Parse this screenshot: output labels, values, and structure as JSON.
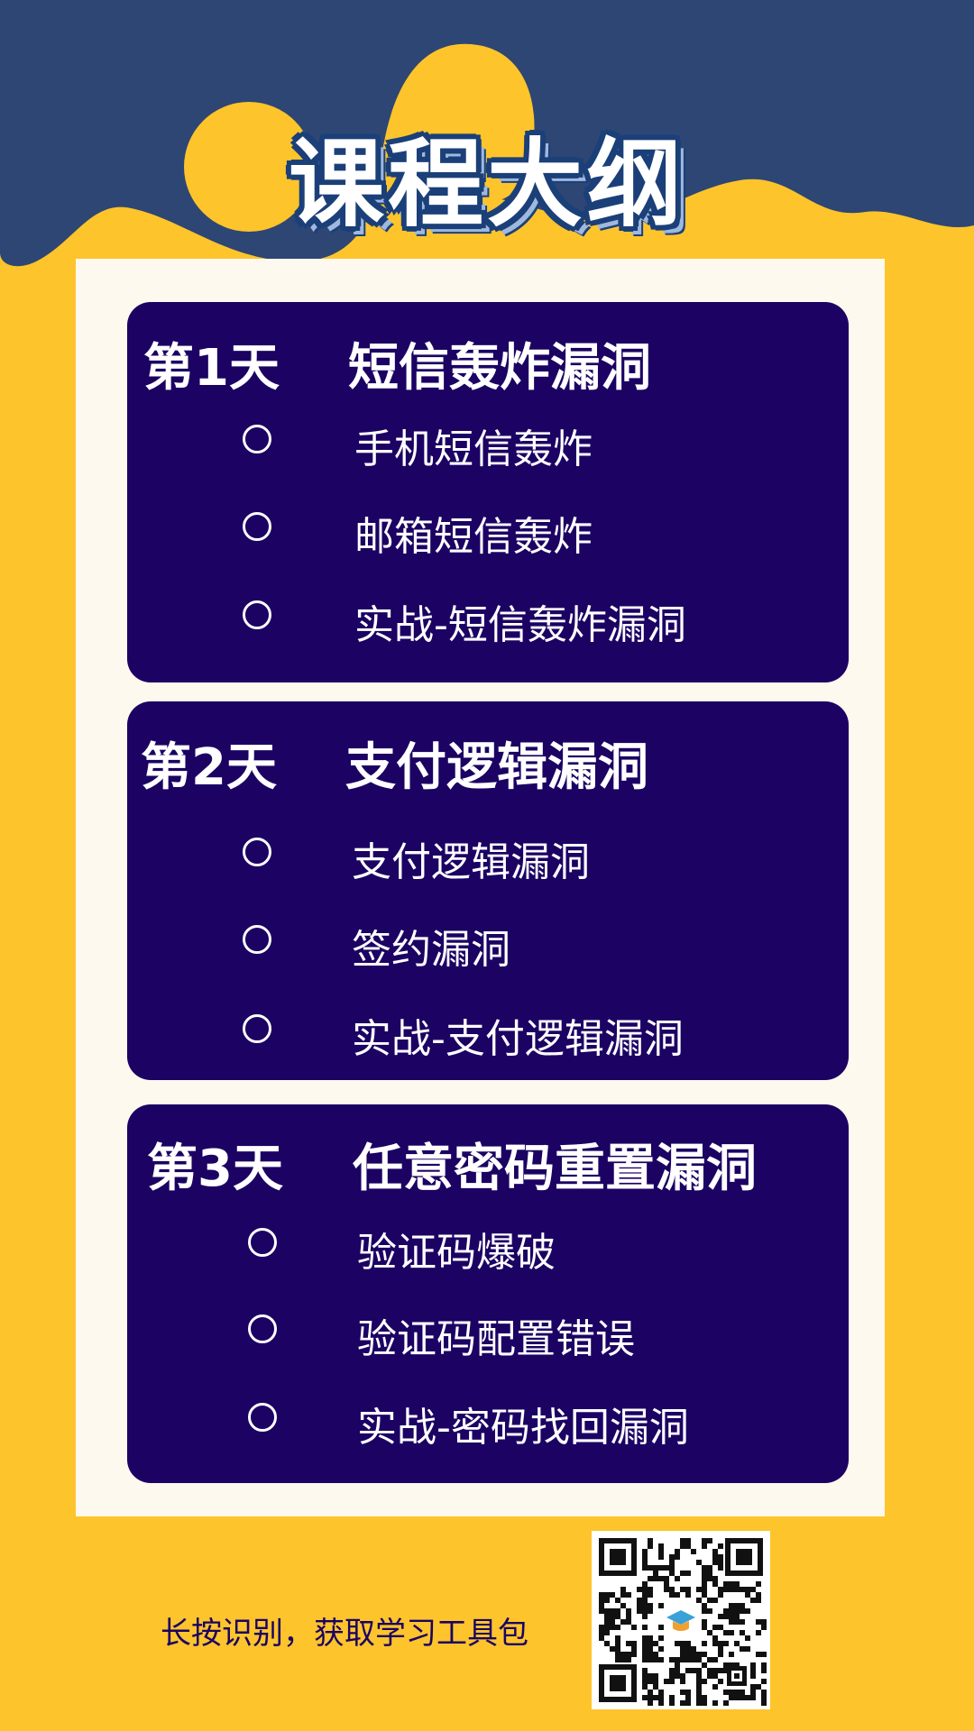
{
  "page": {
    "title": "课程大纲",
    "colors": {
      "background": "#fdc42c",
      "wave": "#2d4673",
      "card": "#1b0263",
      "panel": "#fdf9ef"
    }
  },
  "days": [
    {
      "label": "第1天",
      "topic": "短信轰炸漏洞",
      "items": [
        "手机短信轰炸",
        "邮箱短信轰炸",
        "实战-短信轰炸漏洞"
      ]
    },
    {
      "label": "第2天",
      "topic": "支付逻辑漏洞",
      "items": [
        "支付逻辑漏洞",
        "签约漏洞",
        "实战-支付逻辑漏洞"
      ]
    },
    {
      "label": "第3天",
      "topic": "任意密码重置漏洞",
      "items": [
        "验证码爆破",
        "验证码配置错误",
        "实战-密码找回漏洞"
      ]
    }
  ],
  "footer": {
    "text": "长按识别，获取学习工具包",
    "qr_icon": "qr-code-icon"
  }
}
